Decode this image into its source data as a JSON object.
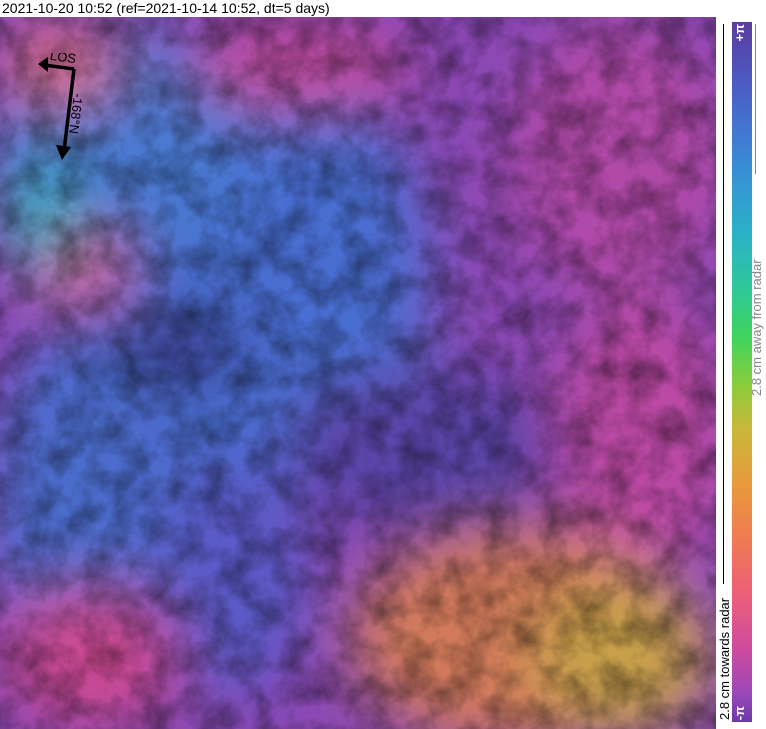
{
  "title": "2021-10-20 10:52 (ref=2021-10-14 10:52, dt=5 days)",
  "compass": {
    "los_label": "LOS",
    "heading_label": "-168°N"
  },
  "colorbar": {
    "top_label": "+π",
    "bottom_label": "-π",
    "away_label": "2.8 cm away from radar",
    "towards_label": "2.8 cm towards radar",
    "colors": [
      "#5a3ca0",
      "#3a8ad6",
      "#2ec89a",
      "#8ccc3c",
      "#e89a3c",
      "#ec5e7a",
      "#6a3aa8"
    ]
  }
}
